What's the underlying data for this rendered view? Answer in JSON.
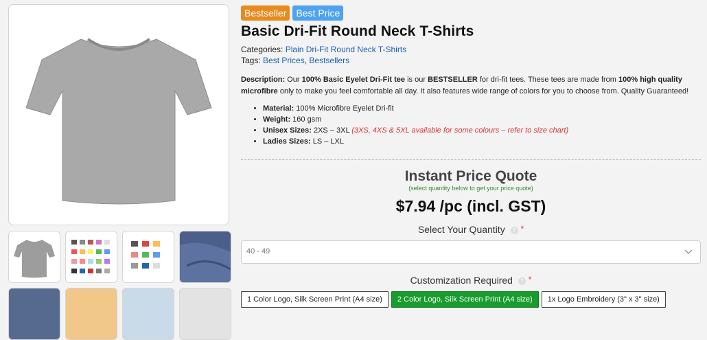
{
  "badges": {
    "bestseller": "Bestseller",
    "best_price": "Best Price"
  },
  "product": {
    "title": "Basic Dri-Fit Round Neck T-Shirts",
    "categories_label": "Categories:",
    "categories_link": "Plain Dri-Fit Round Neck T-Shirts",
    "tags_label": "Tags:",
    "tags": [
      "Best Prices",
      "Bestsellers"
    ],
    "tags_sep": ","
  },
  "description": {
    "label": "Description:",
    "t1": " Our ",
    "b1": "100% Basic Eyelet Dri-Fit tee",
    "t2": " is our ",
    "b2": "BESTSELLER",
    "t3": " for dri-fit tees. These tees are made from ",
    "b3": "100% high quality microfibre",
    "t4": " only to make you feel comfortable all day. It also features wide range of colors for you to choose from. Quality Guaranteed!"
  },
  "specs": [
    {
      "label": "Material:",
      "value": " 100% Microfibre Eyelet Dri-fit",
      "note": ""
    },
    {
      "label": "Weight:",
      "value": " 160 gsm",
      "note": ""
    },
    {
      "label": "Unisex Sizes:",
      "value": " 2XS – 3XL ",
      "note": "(3XS, 4XS & 5XL available for some colours – refer to size chart)"
    },
    {
      "label": "Ladies Sizes:",
      "value": " LS – LXL",
      "note": ""
    }
  ],
  "quote": {
    "title": "Instant Price Quote",
    "subtitle": "(select quantity below to get your price quote)",
    "price": "$7.94 /pc (incl. GST)",
    "quantity_label": "Select Your Quantity",
    "quantity_value": "40 - 49",
    "customization_label": "Customization Required",
    "required_mark": "*",
    "help_mark": "?",
    "options": [
      "1 Color Logo, Silk Screen Print (A4 size)",
      "2 Color Logo, Silk Screen Print (A4 size)",
      "1x Logo Embroidery (3\" x 3\" size)"
    ],
    "selected_option_index": 1
  },
  "icons": {
    "main_image": "grey-tshirt-image",
    "dropdown": "chevron-down-icon",
    "help": "question-circle-icon"
  },
  "colors": {
    "accent_orange": "#e88a1d",
    "accent_blue": "#4ea3f0",
    "link": "#1a5fb4",
    "selected_green": "#189c2e",
    "note_red": "#d33"
  }
}
